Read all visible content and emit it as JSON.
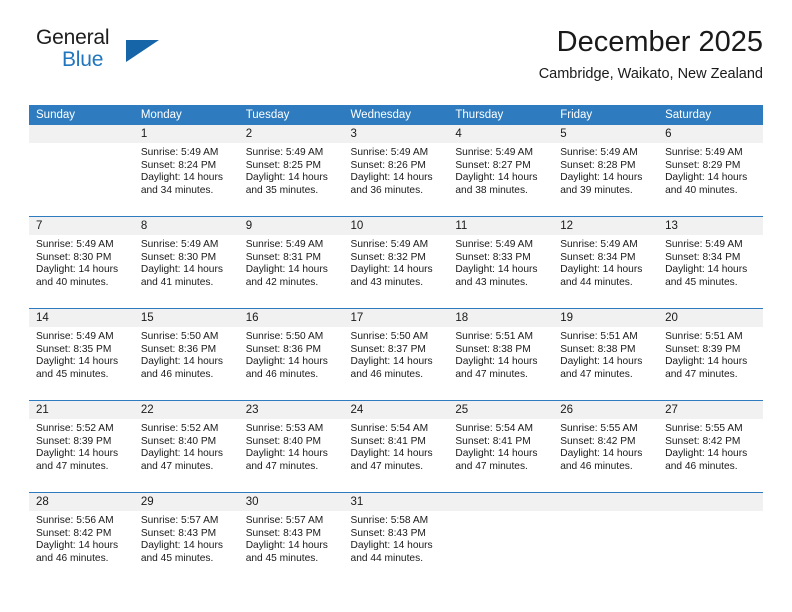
{
  "brand": {
    "name_part1": "General",
    "name_part2": "Blue",
    "triangle_icon": "triangle-icon"
  },
  "header": {
    "month_title": "December 2025",
    "location": "Cambridge, Waikato, New Zealand",
    "accent_color": "#2e7cbf",
    "brand_blue": "#2176bd",
    "daynum_band_color": "#f1f1f1"
  },
  "weekday_headers": [
    "Sunday",
    "Monday",
    "Tuesday",
    "Wednesday",
    "Thursday",
    "Friday",
    "Saturday"
  ],
  "weeks": [
    [
      {
        "day": "",
        "sunrise": "",
        "sunset": "",
        "daylight_line1": "",
        "daylight_line2": ""
      },
      {
        "day": "1",
        "sunrise": "Sunrise: 5:49 AM",
        "sunset": "Sunset: 8:24 PM",
        "daylight_line1": "Daylight: 14 hours",
        "daylight_line2": "and 34 minutes."
      },
      {
        "day": "2",
        "sunrise": "Sunrise: 5:49 AM",
        "sunset": "Sunset: 8:25 PM",
        "daylight_line1": "Daylight: 14 hours",
        "daylight_line2": "and 35 minutes."
      },
      {
        "day": "3",
        "sunrise": "Sunrise: 5:49 AM",
        "sunset": "Sunset: 8:26 PM",
        "daylight_line1": "Daylight: 14 hours",
        "daylight_line2": "and 36 minutes."
      },
      {
        "day": "4",
        "sunrise": "Sunrise: 5:49 AM",
        "sunset": "Sunset: 8:27 PM",
        "daylight_line1": "Daylight: 14 hours",
        "daylight_line2": "and 38 minutes."
      },
      {
        "day": "5",
        "sunrise": "Sunrise: 5:49 AM",
        "sunset": "Sunset: 8:28 PM",
        "daylight_line1": "Daylight: 14 hours",
        "daylight_line2": "and 39 minutes."
      },
      {
        "day": "6",
        "sunrise": "Sunrise: 5:49 AM",
        "sunset": "Sunset: 8:29 PM",
        "daylight_line1": "Daylight: 14 hours",
        "daylight_line2": "and 40 minutes."
      }
    ],
    [
      {
        "day": "7",
        "sunrise": "Sunrise: 5:49 AM",
        "sunset": "Sunset: 8:30 PM",
        "daylight_line1": "Daylight: 14 hours",
        "daylight_line2": "and 40 minutes."
      },
      {
        "day": "8",
        "sunrise": "Sunrise: 5:49 AM",
        "sunset": "Sunset: 8:30 PM",
        "daylight_line1": "Daylight: 14 hours",
        "daylight_line2": "and 41 minutes."
      },
      {
        "day": "9",
        "sunrise": "Sunrise: 5:49 AM",
        "sunset": "Sunset: 8:31 PM",
        "daylight_line1": "Daylight: 14 hours",
        "daylight_line2": "and 42 minutes."
      },
      {
        "day": "10",
        "sunrise": "Sunrise: 5:49 AM",
        "sunset": "Sunset: 8:32 PM",
        "daylight_line1": "Daylight: 14 hours",
        "daylight_line2": "and 43 minutes."
      },
      {
        "day": "11",
        "sunrise": "Sunrise: 5:49 AM",
        "sunset": "Sunset: 8:33 PM",
        "daylight_line1": "Daylight: 14 hours",
        "daylight_line2": "and 43 minutes."
      },
      {
        "day": "12",
        "sunrise": "Sunrise: 5:49 AM",
        "sunset": "Sunset: 8:34 PM",
        "daylight_line1": "Daylight: 14 hours",
        "daylight_line2": "and 44 minutes."
      },
      {
        "day": "13",
        "sunrise": "Sunrise: 5:49 AM",
        "sunset": "Sunset: 8:34 PM",
        "daylight_line1": "Daylight: 14 hours",
        "daylight_line2": "and 45 minutes."
      }
    ],
    [
      {
        "day": "14",
        "sunrise": "Sunrise: 5:49 AM",
        "sunset": "Sunset: 8:35 PM",
        "daylight_line1": "Daylight: 14 hours",
        "daylight_line2": "and 45 minutes."
      },
      {
        "day": "15",
        "sunrise": "Sunrise: 5:50 AM",
        "sunset": "Sunset: 8:36 PM",
        "daylight_line1": "Daylight: 14 hours",
        "daylight_line2": "and 46 minutes."
      },
      {
        "day": "16",
        "sunrise": "Sunrise: 5:50 AM",
        "sunset": "Sunset: 8:36 PM",
        "daylight_line1": "Daylight: 14 hours",
        "daylight_line2": "and 46 minutes."
      },
      {
        "day": "17",
        "sunrise": "Sunrise: 5:50 AM",
        "sunset": "Sunset: 8:37 PM",
        "daylight_line1": "Daylight: 14 hours",
        "daylight_line2": "and 46 minutes."
      },
      {
        "day": "18",
        "sunrise": "Sunrise: 5:51 AM",
        "sunset": "Sunset: 8:38 PM",
        "daylight_line1": "Daylight: 14 hours",
        "daylight_line2": "and 47 minutes."
      },
      {
        "day": "19",
        "sunrise": "Sunrise: 5:51 AM",
        "sunset": "Sunset: 8:38 PM",
        "daylight_line1": "Daylight: 14 hours",
        "daylight_line2": "and 47 minutes."
      },
      {
        "day": "20",
        "sunrise": "Sunrise: 5:51 AM",
        "sunset": "Sunset: 8:39 PM",
        "daylight_line1": "Daylight: 14 hours",
        "daylight_line2": "and 47 minutes."
      }
    ],
    [
      {
        "day": "21",
        "sunrise": "Sunrise: 5:52 AM",
        "sunset": "Sunset: 8:39 PM",
        "daylight_line1": "Daylight: 14 hours",
        "daylight_line2": "and 47 minutes."
      },
      {
        "day": "22",
        "sunrise": "Sunrise: 5:52 AM",
        "sunset": "Sunset: 8:40 PM",
        "daylight_line1": "Daylight: 14 hours",
        "daylight_line2": "and 47 minutes."
      },
      {
        "day": "23",
        "sunrise": "Sunrise: 5:53 AM",
        "sunset": "Sunset: 8:40 PM",
        "daylight_line1": "Daylight: 14 hours",
        "daylight_line2": "and 47 minutes."
      },
      {
        "day": "24",
        "sunrise": "Sunrise: 5:54 AM",
        "sunset": "Sunset: 8:41 PM",
        "daylight_line1": "Daylight: 14 hours",
        "daylight_line2": "and 47 minutes."
      },
      {
        "day": "25",
        "sunrise": "Sunrise: 5:54 AM",
        "sunset": "Sunset: 8:41 PM",
        "daylight_line1": "Daylight: 14 hours",
        "daylight_line2": "and 47 minutes."
      },
      {
        "day": "26",
        "sunrise": "Sunrise: 5:55 AM",
        "sunset": "Sunset: 8:42 PM",
        "daylight_line1": "Daylight: 14 hours",
        "daylight_line2": "and 46 minutes."
      },
      {
        "day": "27",
        "sunrise": "Sunrise: 5:55 AM",
        "sunset": "Sunset: 8:42 PM",
        "daylight_line1": "Daylight: 14 hours",
        "daylight_line2": "and 46 minutes."
      }
    ],
    [
      {
        "day": "28",
        "sunrise": "Sunrise: 5:56 AM",
        "sunset": "Sunset: 8:42 PM",
        "daylight_line1": "Daylight: 14 hours",
        "daylight_line2": "and 46 minutes."
      },
      {
        "day": "29",
        "sunrise": "Sunrise: 5:57 AM",
        "sunset": "Sunset: 8:43 PM",
        "daylight_line1": "Daylight: 14 hours",
        "daylight_line2": "and 45 minutes."
      },
      {
        "day": "30",
        "sunrise": "Sunrise: 5:57 AM",
        "sunset": "Sunset: 8:43 PM",
        "daylight_line1": "Daylight: 14 hours",
        "daylight_line2": "and 45 minutes."
      },
      {
        "day": "31",
        "sunrise": "Sunrise: 5:58 AM",
        "sunset": "Sunset: 8:43 PM",
        "daylight_line1": "Daylight: 14 hours",
        "daylight_line2": "and 44 minutes."
      },
      {
        "day": "",
        "sunrise": "",
        "sunset": "",
        "daylight_line1": "",
        "daylight_line2": ""
      },
      {
        "day": "",
        "sunrise": "",
        "sunset": "",
        "daylight_line1": "",
        "daylight_line2": ""
      },
      {
        "day": "",
        "sunrise": "",
        "sunset": "",
        "daylight_line1": "",
        "daylight_line2": ""
      }
    ]
  ]
}
